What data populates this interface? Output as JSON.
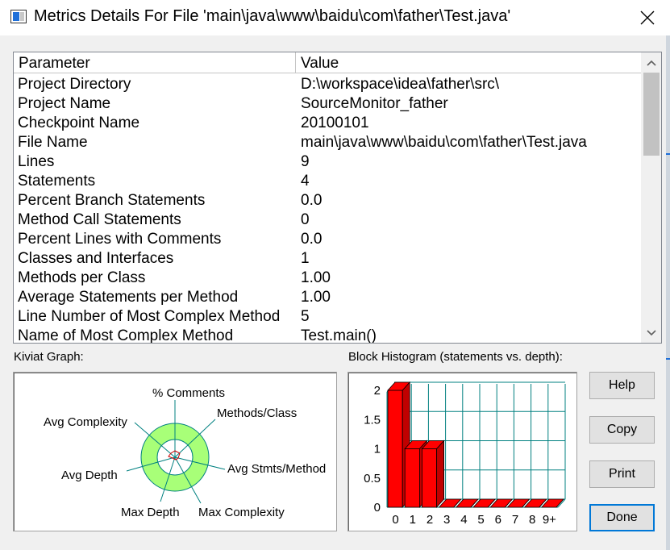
{
  "window": {
    "title": "Metrics Details For File 'main\\java\\www\\baidu\\com\\father\\Test.java'"
  },
  "icons": {
    "app": "app-window-icon",
    "close": "close-icon"
  },
  "table": {
    "headers": {
      "parameter": "Parameter",
      "value": "Value"
    },
    "rows": [
      {
        "param": "Project Directory",
        "value": "D:\\workspace\\idea\\father\\src\\"
      },
      {
        "param": "Project Name",
        "value": "SourceMonitor_father"
      },
      {
        "param": "Checkpoint Name",
        "value": "20100101"
      },
      {
        "param": "File Name",
        "value": "main\\java\\www\\baidu\\com\\father\\Test.java"
      },
      {
        "param": "Lines",
        "value": "9"
      },
      {
        "param": "Statements",
        "value": "4"
      },
      {
        "param": "Percent Branch Statements",
        "value": "0.0"
      },
      {
        "param": "Method Call Statements",
        "value": "0"
      },
      {
        "param": "Percent Lines with Comments",
        "value": "0.0"
      },
      {
        "param": "Classes and Interfaces",
        "value": "1"
      },
      {
        "param": "Methods per Class",
        "value": "1.00"
      },
      {
        "param": "Average Statements per Method",
        "value": "1.00"
      },
      {
        "param": "Line Number of Most Complex Method",
        "value": "5"
      },
      {
        "param": "Name of Most Complex Method",
        "value": "Test.main()"
      }
    ]
  },
  "kiviat": {
    "label": "Kiviat Graph:",
    "axes": [
      "% Comments",
      "Methods/Class",
      "Avg Stmts/Method",
      "Max Complexity",
      "Max Depth",
      "Avg Depth",
      "Avg Complexity"
    ]
  },
  "histogram": {
    "label": "Block Histogram (statements vs. depth):"
  },
  "chart_data": {
    "type": "bar",
    "categories": [
      "0",
      "1",
      "2",
      "3",
      "4",
      "5",
      "6",
      "7",
      "8",
      "9+"
    ],
    "values": [
      2,
      1,
      1,
      0,
      0,
      0,
      0,
      0,
      0,
      0
    ],
    "y_ticks": [
      "0",
      "0.5",
      "1",
      "1.5",
      "2"
    ],
    "ylim": [
      0,
      2
    ],
    "bar_color": "#ff0000",
    "grid_color": "#008080",
    "grid": true
  },
  "buttons": {
    "help": "Help",
    "copy": "Copy",
    "print": "Print",
    "done": "Done"
  }
}
